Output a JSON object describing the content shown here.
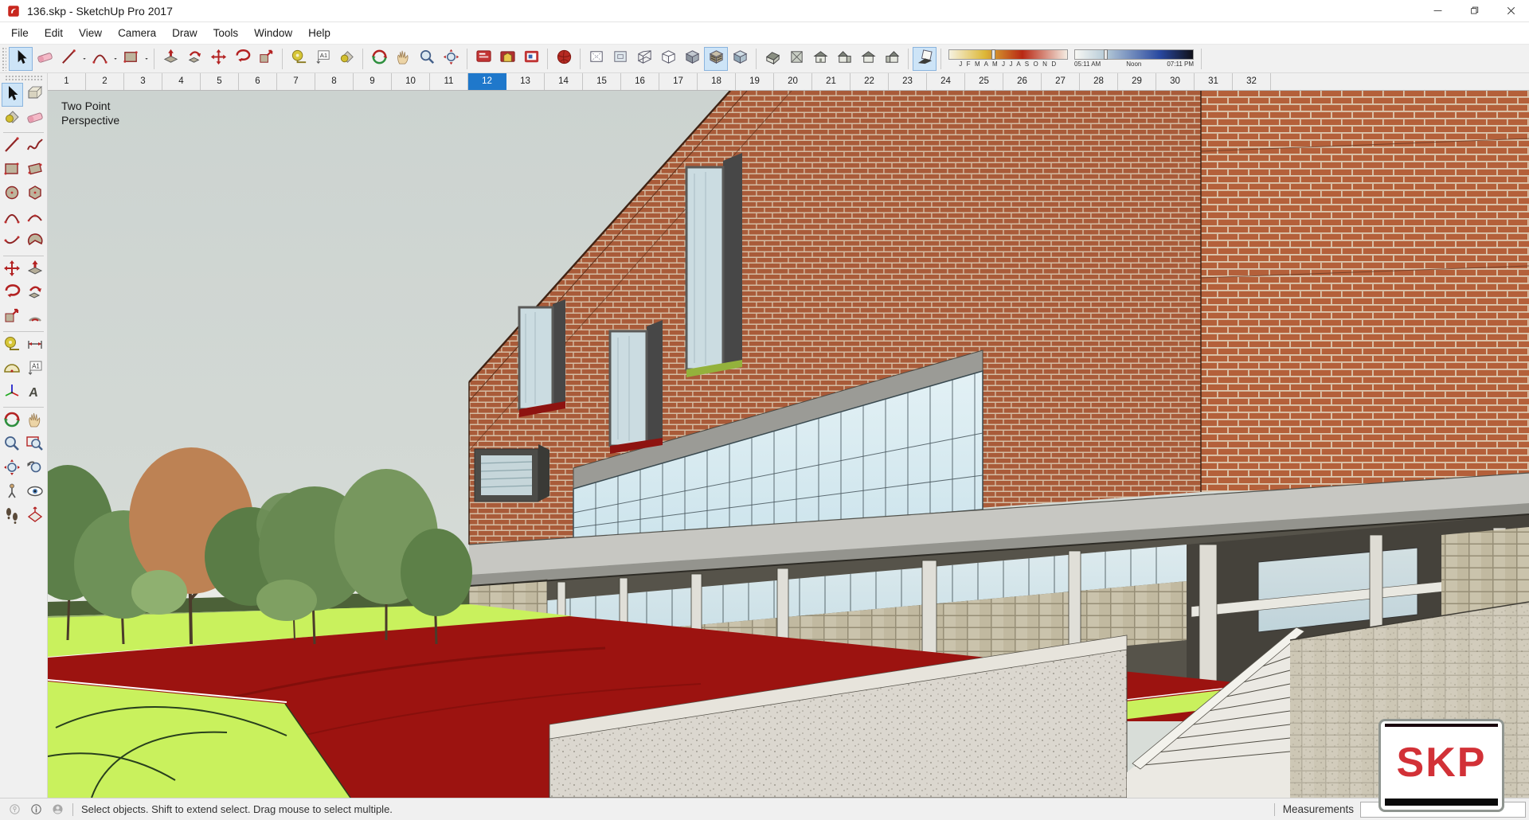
{
  "window": {
    "title": "136.skp - SketchUp Pro 2017"
  },
  "menu": {
    "items": [
      "File",
      "Edit",
      "View",
      "Camera",
      "Draw",
      "Tools",
      "Window",
      "Help"
    ]
  },
  "toolbar": {
    "groups": [
      {
        "tools": [
          {
            "name": "select",
            "active": true
          },
          {
            "name": "eraser"
          },
          {
            "name": "line",
            "dropdown": true
          },
          {
            "name": "arc",
            "dropdown": true
          },
          {
            "name": "rectangle",
            "dropdown": true
          }
        ]
      },
      {
        "tools": [
          {
            "name": "push-pull"
          },
          {
            "name": "follow-me"
          },
          {
            "name": "move"
          },
          {
            "name": "rotate"
          },
          {
            "name": "scale"
          }
        ]
      },
      {
        "tools": [
          {
            "name": "tape-measure"
          },
          {
            "name": "text"
          },
          {
            "name": "paint-bucket"
          }
        ]
      },
      {
        "tools": [
          {
            "name": "orbit"
          },
          {
            "name": "pan"
          },
          {
            "name": "zoom"
          },
          {
            "name": "zoom-extents"
          }
        ]
      },
      {
        "tools": [
          {
            "name": "model-info"
          },
          {
            "name": "3d-warehouse"
          },
          {
            "name": "layout"
          }
        ]
      },
      {
        "tools": [
          {
            "name": "red-sphere"
          }
        ]
      },
      {
        "tools": [
          {
            "name": "style-back-edges"
          },
          {
            "name": "style-x-ray"
          },
          {
            "name": "style-wireframe"
          },
          {
            "name": "style-hidden-line"
          },
          {
            "name": "style-shaded"
          },
          {
            "name": "style-textured",
            "active": true
          },
          {
            "name": "style-monochrome"
          }
        ]
      },
      {
        "tools": [
          {
            "name": "view-iso"
          },
          {
            "name": "view-top"
          },
          {
            "name": "view-front"
          },
          {
            "name": "view-right"
          },
          {
            "name": "view-back"
          },
          {
            "name": "view-left"
          }
        ]
      },
      {
        "tools": [
          {
            "name": "shadow-toggle",
            "active": true
          }
        ]
      }
    ],
    "shadows": {
      "months_label": "J F M A M J J A S O N D",
      "date_position": 0.36,
      "time_start": "05:11 AM",
      "time_noon": "Noon",
      "time_end": "07:11 PM",
      "time_position": 0.24
    }
  },
  "scene_tabs": {
    "tabs": [
      "1",
      "2",
      "3",
      "4",
      "5",
      "6",
      "7",
      "8",
      "9",
      "10",
      "11",
      "12",
      "13",
      "14",
      "15",
      "16",
      "17",
      "18",
      "19",
      "20",
      "21",
      "22",
      "23",
      "24",
      "25",
      "26",
      "27",
      "28",
      "29",
      "30",
      "31",
      "32"
    ],
    "active_index": 11
  },
  "tool_palette": {
    "rows": [
      [
        "select",
        "make-component"
      ],
      [
        "paint-bucket",
        "eraser"
      ],
      [
        "line",
        "freehand"
      ],
      [
        "rectangle",
        "rotated-rectangle"
      ],
      [
        "circle",
        "polygon"
      ],
      [
        "arc",
        "two-point-arc"
      ],
      [
        "three-point-arc",
        "pie"
      ],
      [
        "move",
        "push-pull"
      ],
      [
        "rotate",
        "follow-me"
      ],
      [
        "scale",
        "offset"
      ],
      [
        "tape-measure",
        "dimension"
      ],
      [
        "protractor",
        "text"
      ],
      [
        "axes",
        "3d-text"
      ],
      [
        "orbit",
        "pan"
      ],
      [
        "zoom",
        "zoom-window"
      ],
      [
        "zoom-extents",
        "previous"
      ],
      [
        "position-camera",
        "look-around"
      ],
      [
        "walk",
        "section-plane"
      ]
    ],
    "dividers_after_rows": [
      1,
      6,
      9,
      12
    ],
    "active_tool": "select"
  },
  "viewport": {
    "camera_label_line1": "Two Point",
    "camera_label_line2": "Perspective"
  },
  "watermark": {
    "text": "SKP"
  },
  "status_bar": {
    "message": "Select objects. Shift to extend select. Drag mouse to select multiple.",
    "measurements_label": "Measurements",
    "measurements_value": ""
  },
  "colors": {
    "active_tab": "#1f78cb",
    "selection_highlight": "#cde4f7",
    "sky": "#cfd6d2",
    "brick": "#b06240",
    "track_red": "#9c1310",
    "field_green": "#c9f15d"
  }
}
